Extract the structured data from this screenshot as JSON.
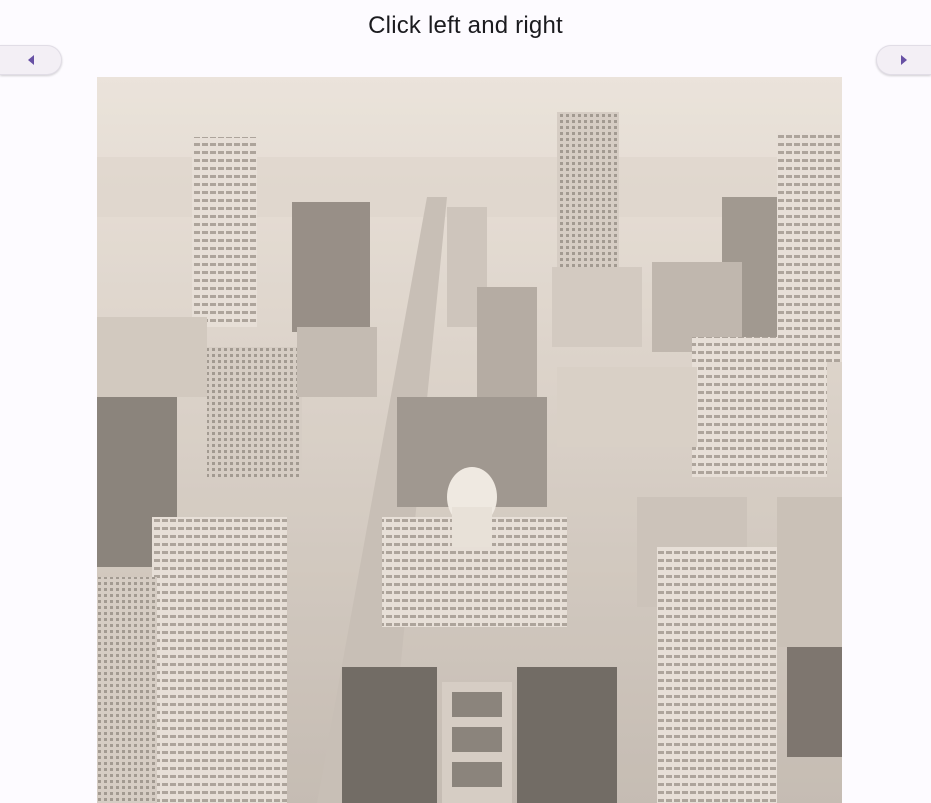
{
  "header": {
    "title": "Click left and right"
  },
  "nav": {
    "prev_icon": "arrow-left-icon",
    "next_icon": "arrow-right-icon",
    "accent": "#6750a4"
  },
  "photo": {
    "subject": "aerial city skyline",
    "tint": "#e6ddd5"
  }
}
